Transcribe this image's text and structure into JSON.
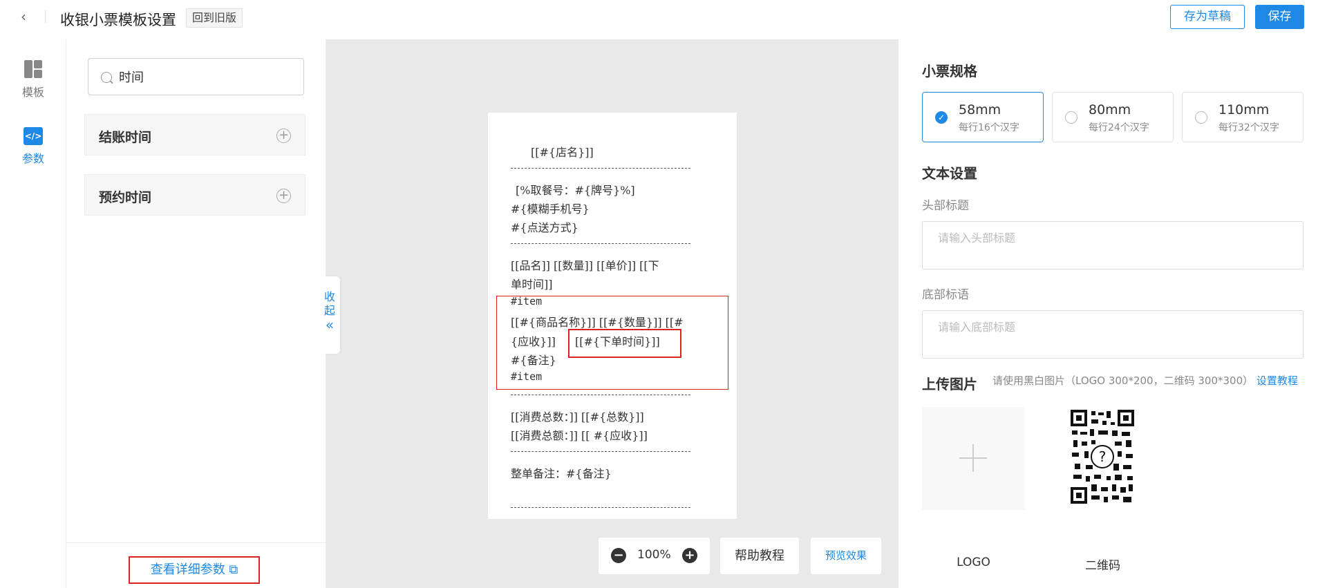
{
  "header": {
    "back_icon": "chevron-left-icon",
    "title": "收银小票模板设置",
    "old_version": "回到旧版",
    "save_draft": "存为草稿",
    "save": "保存"
  },
  "rail": {
    "template": "模板",
    "params": "参数"
  },
  "panel": {
    "search_value": "时间",
    "items": [
      {
        "label": "结账时间"
      },
      {
        "label": "预约时间"
      }
    ],
    "detail_link": "查看详细参数"
  },
  "canvas": {
    "collapse": [
      "收",
      "起",
      "«"
    ],
    "receipt": [
      "[[#{店名}]]",
      "[%取餐号：#{牌号}%]",
      "#{模糊手机号}",
      "#{点送方式}",
      "[[品名]] [[数量]] [[单价]] [[下",
      "单时间]]",
      "#item",
      "[[#{商品名称}]] [[#{数量}]] [[#",
      "{应收}]]",
      "[[#{下单时间}]]",
      "#{备注}",
      "#item",
      "[[消费总数：]] [[#{总数}]]",
      "[[消费总额：]] [[ #{应收}]]",
      "整单备注：#{备注}"
    ],
    "zoom": "100%",
    "help": "帮助教程",
    "preview": "预览效果"
  },
  "right": {
    "spec_title": "小票规格",
    "specs": [
      {
        "size": "58mm",
        "desc": "每行16个汉字",
        "selected": true
      },
      {
        "size": "80mm",
        "desc": "每行24个汉字",
        "selected": false
      },
      {
        "size": "110mm",
        "desc": "每行32个汉字",
        "selected": false
      }
    ],
    "text_title": "文本设置",
    "header_label": "头部标题",
    "header_placeholder": "请输入头部标题",
    "footer_label": "底部标语",
    "footer_placeholder": "请输入底部标题",
    "upload_title": "上传图片",
    "upload_tip": "请使用黑白图片（LOGO 300*200，二维码 300*300）",
    "upload_link": "设置教程",
    "logo_label": "LOGO",
    "qr_label": "二维码"
  },
  "colors": {
    "accent": "#1e88e5",
    "highlight": "#e02020",
    "canvas_bg": "#e9e9e9"
  }
}
